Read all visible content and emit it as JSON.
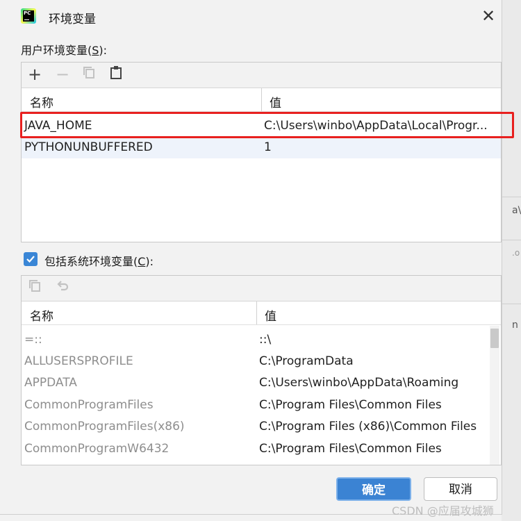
{
  "dialog": {
    "title": "环境变量",
    "app_icon_text": "PC"
  },
  "user_section": {
    "label_prefix": "用户环境变量(",
    "label_mnemonic": "S",
    "label_suffix": "):",
    "columns": [
      "名称",
      "值"
    ],
    "rows": [
      {
        "name": "JAVA_HOME",
        "value": "C:\\Users\\winbo\\AppData\\Local\\Progr..."
      },
      {
        "name": "PYTHONUNBUFFERED",
        "value": "1"
      }
    ]
  },
  "system_section": {
    "label_prefix": "包括系统环境变量(",
    "label_mnemonic": "C",
    "label_suffix": "):",
    "checked": true,
    "columns": [
      "名称",
      "值"
    ],
    "rows": [
      {
        "name": "=::",
        "value": "::\\"
      },
      {
        "name": "ALLUSERSPROFILE",
        "value": "C:\\ProgramData"
      },
      {
        "name": "APPDATA",
        "value": "C:\\Users\\winbo\\AppData\\Roaming"
      },
      {
        "name": "CommonProgramFiles",
        "value": "C:\\Program Files\\Common Files"
      },
      {
        "name": "CommonProgramFiles(x86)",
        "value": "C:\\Program Files (x86)\\Common Files"
      },
      {
        "name": "CommonProgramW6432",
        "value": "C:\\Program Files\\Common Files"
      }
    ]
  },
  "buttons": {
    "ok": "确定",
    "cancel": "取消"
  },
  "background_fragments": [
    "a\\",
    ".o",
    "n"
  ],
  "watermark": "CSDN @应届攻城狮",
  "colors": {
    "accent": "#3b83d3",
    "highlight": "#e8201f",
    "alt_row": "#eef3fb"
  }
}
